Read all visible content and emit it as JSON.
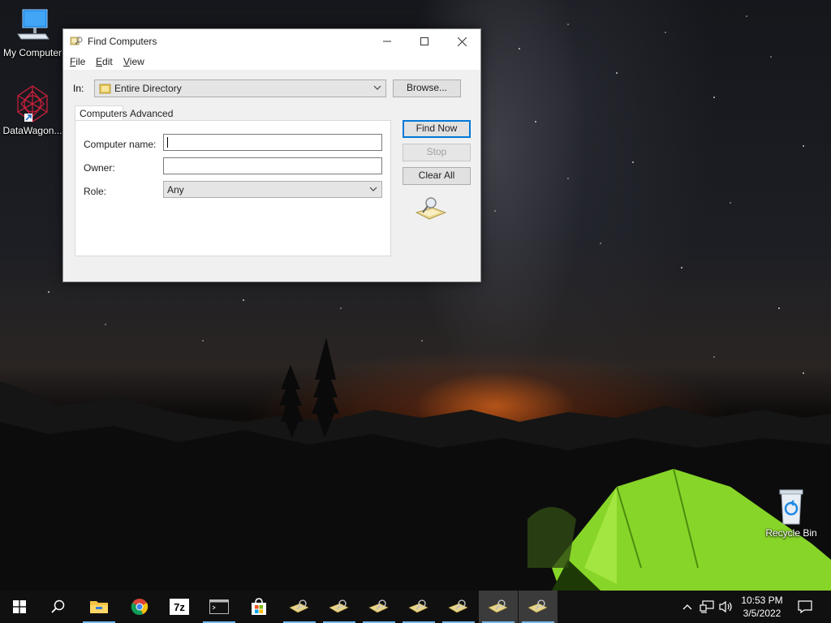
{
  "desktop": {
    "icons": [
      {
        "label": "My Computer",
        "icon": "computer-icon"
      },
      {
        "label": "DataWagon...",
        "icon": "datawagon-icon"
      },
      {
        "label": "Recycle Bin",
        "icon": "recycle-bin-icon"
      }
    ]
  },
  "window": {
    "title": "Find Computers",
    "controls": [
      "minimize-icon",
      "maximize-icon",
      "close-icon"
    ],
    "menu": [
      {
        "label": "File",
        "mnemonic": "F",
        "rest": "ile"
      },
      {
        "label": "Edit",
        "mnemonic": "E",
        "rest": "dit"
      },
      {
        "label": "View",
        "mnemonic": "V",
        "rest": "iew"
      }
    ],
    "in_label": "In:",
    "in_value": "Entire Directory",
    "browse_label": "Browse...",
    "tabs": [
      {
        "label": "Computers",
        "active": true
      },
      {
        "label": "Advanced",
        "active": false
      }
    ],
    "fields": {
      "computer_name_label": "Computer name:",
      "computer_name_value": "",
      "owner_label": "Owner:",
      "owner_value": "",
      "role_label": "Role:",
      "role_value": "Any"
    },
    "buttons": {
      "find_now": "Find Now",
      "stop": "Stop",
      "clear_all": "Clear All"
    }
  },
  "taskbar": {
    "apps": [
      {
        "icon": "start-icon"
      },
      {
        "icon": "search-icon"
      },
      {
        "icon": "file-explorer-icon"
      },
      {
        "icon": "chrome-icon"
      },
      {
        "icon": "7zip-icon"
      },
      {
        "icon": "terminal-icon"
      },
      {
        "icon": "store-icon"
      },
      {
        "icon": "find-computers-icon"
      }
    ],
    "clock_time": "10:53 PM",
    "clock_date": "3/5/2022",
    "tray_icons": [
      "chevron-up-icon",
      "network-icon",
      "volume-icon",
      "notification-icon"
    ]
  },
  "colors": {
    "accent": "#0078d7",
    "taskbar": "#101010",
    "tent": "#8ee02a"
  }
}
